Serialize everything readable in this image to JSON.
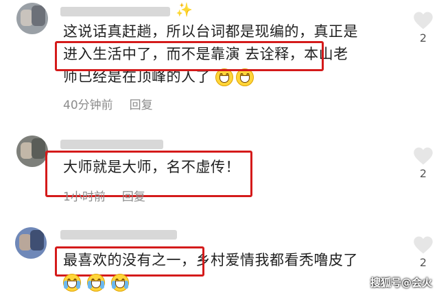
{
  "comments": [
    {
      "lines": [
        "这说话真赶趟，所以台词都是现编的，真正是",
        "进入生活中了，而不是靠演 去诠释，本山老",
        "师已经是在顶峰的人了"
      ],
      "time": "40分钟前",
      "reply": "回复",
      "likes": "2"
    },
    {
      "lines": [
        "大师就是大师，名不虚传！"
      ],
      "time": "1小时前",
      "reply": "回复",
      "likes": "2"
    },
    {
      "lines": [
        "最喜欢的没有之一，乡村爱情我都看秃噜皮了"
      ],
      "time": "",
      "reply": "",
      "likes": "2"
    }
  ],
  "watermark": "搜狐号@会火",
  "colors": {
    "highlight": "#d41a1a",
    "meta": "#8c8c8c"
  },
  "icons": [
    "heart-icon",
    "grin-emoji",
    "laugh-cry-emoji",
    "sparkle-icon"
  ]
}
